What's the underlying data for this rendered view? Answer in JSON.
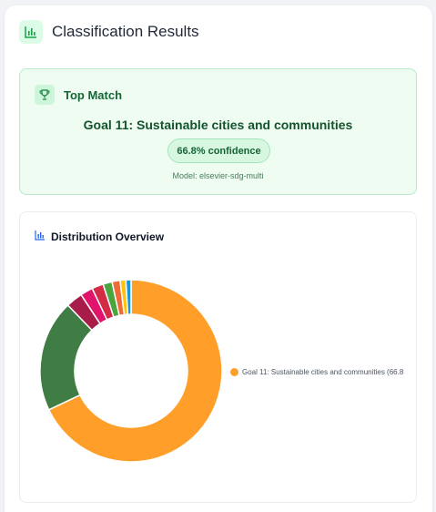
{
  "header": {
    "title": "Classification Results",
    "icon": "bar-chart-icon"
  },
  "top_match": {
    "label": "Top Match",
    "icon": "trophy-icon",
    "goal": "Goal 11: Sustainable cities and communities",
    "confidence": "66.8% confidence",
    "model": "Model: elsevier-sdg-multi"
  },
  "distribution": {
    "title": "Distribution Overview",
    "icon": "bar-chart-icon",
    "legend_label": "Goal 11: Sustainable cities and communities (66.8"
  },
  "chart_data": {
    "type": "pie",
    "slices": [
      {
        "value": 66.8,
        "color": "#ff9f2a"
      },
      {
        "value": 19.5,
        "color": "#3f7d45"
      },
      {
        "value": 2.9,
        "color": "#a71c48"
      },
      {
        "value": 2.2,
        "color": "#e0146b"
      },
      {
        "value": 2.0,
        "color": "#d52a45"
      },
      {
        "value": 1.6,
        "color": "#4aa53d"
      },
      {
        "value": 1.4,
        "color": "#f06a36"
      },
      {
        "value": 1.0,
        "color": "#ffc20e"
      },
      {
        "value": 0.9,
        "color": "#1c96d7"
      }
    ],
    "legend": [
      {
        "label": "Goal 11: Sustainable cities and communities (66.8",
        "color": "#ff9f2a"
      }
    ]
  }
}
